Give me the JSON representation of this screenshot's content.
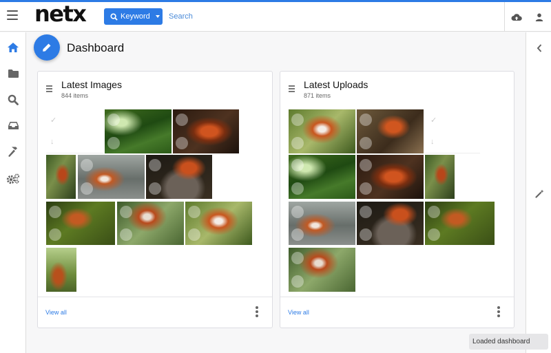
{
  "header": {
    "logo": "netx",
    "keyword_button": "Keyword",
    "search_placeholder": "Search"
  },
  "page": {
    "title": "Dashboard"
  },
  "sidebar": {
    "icons": [
      "home-icon",
      "folder-icon",
      "search-icon",
      "inbox-icon",
      "hammer-icon",
      "cogs-icon"
    ],
    "active": "home-icon"
  },
  "cards": [
    {
      "title": "Latest Images",
      "count": "844 items",
      "view_all": "View all",
      "thumbs": [
        "waterfall",
        "panda-curled",
        "panda-tree",
        "panda-fence",
        "panda-barrel",
        "panda-branch",
        "panda-bamboo",
        "panda-face",
        "panda-small"
      ]
    },
    {
      "title": "Latest Uploads",
      "count": "871 items",
      "view_all": "View all",
      "thumbs": [
        "panda-face",
        "panda-log",
        "waterfall",
        "panda-curled",
        "panda-tree",
        "panda-fence",
        "panda-barrel",
        "panda-branch",
        "panda-bamboo"
      ]
    }
  ],
  "toast": "Loaded dashboard",
  "colors": {
    "accent": "#2d7be5",
    "topline": "#2d7be5"
  }
}
